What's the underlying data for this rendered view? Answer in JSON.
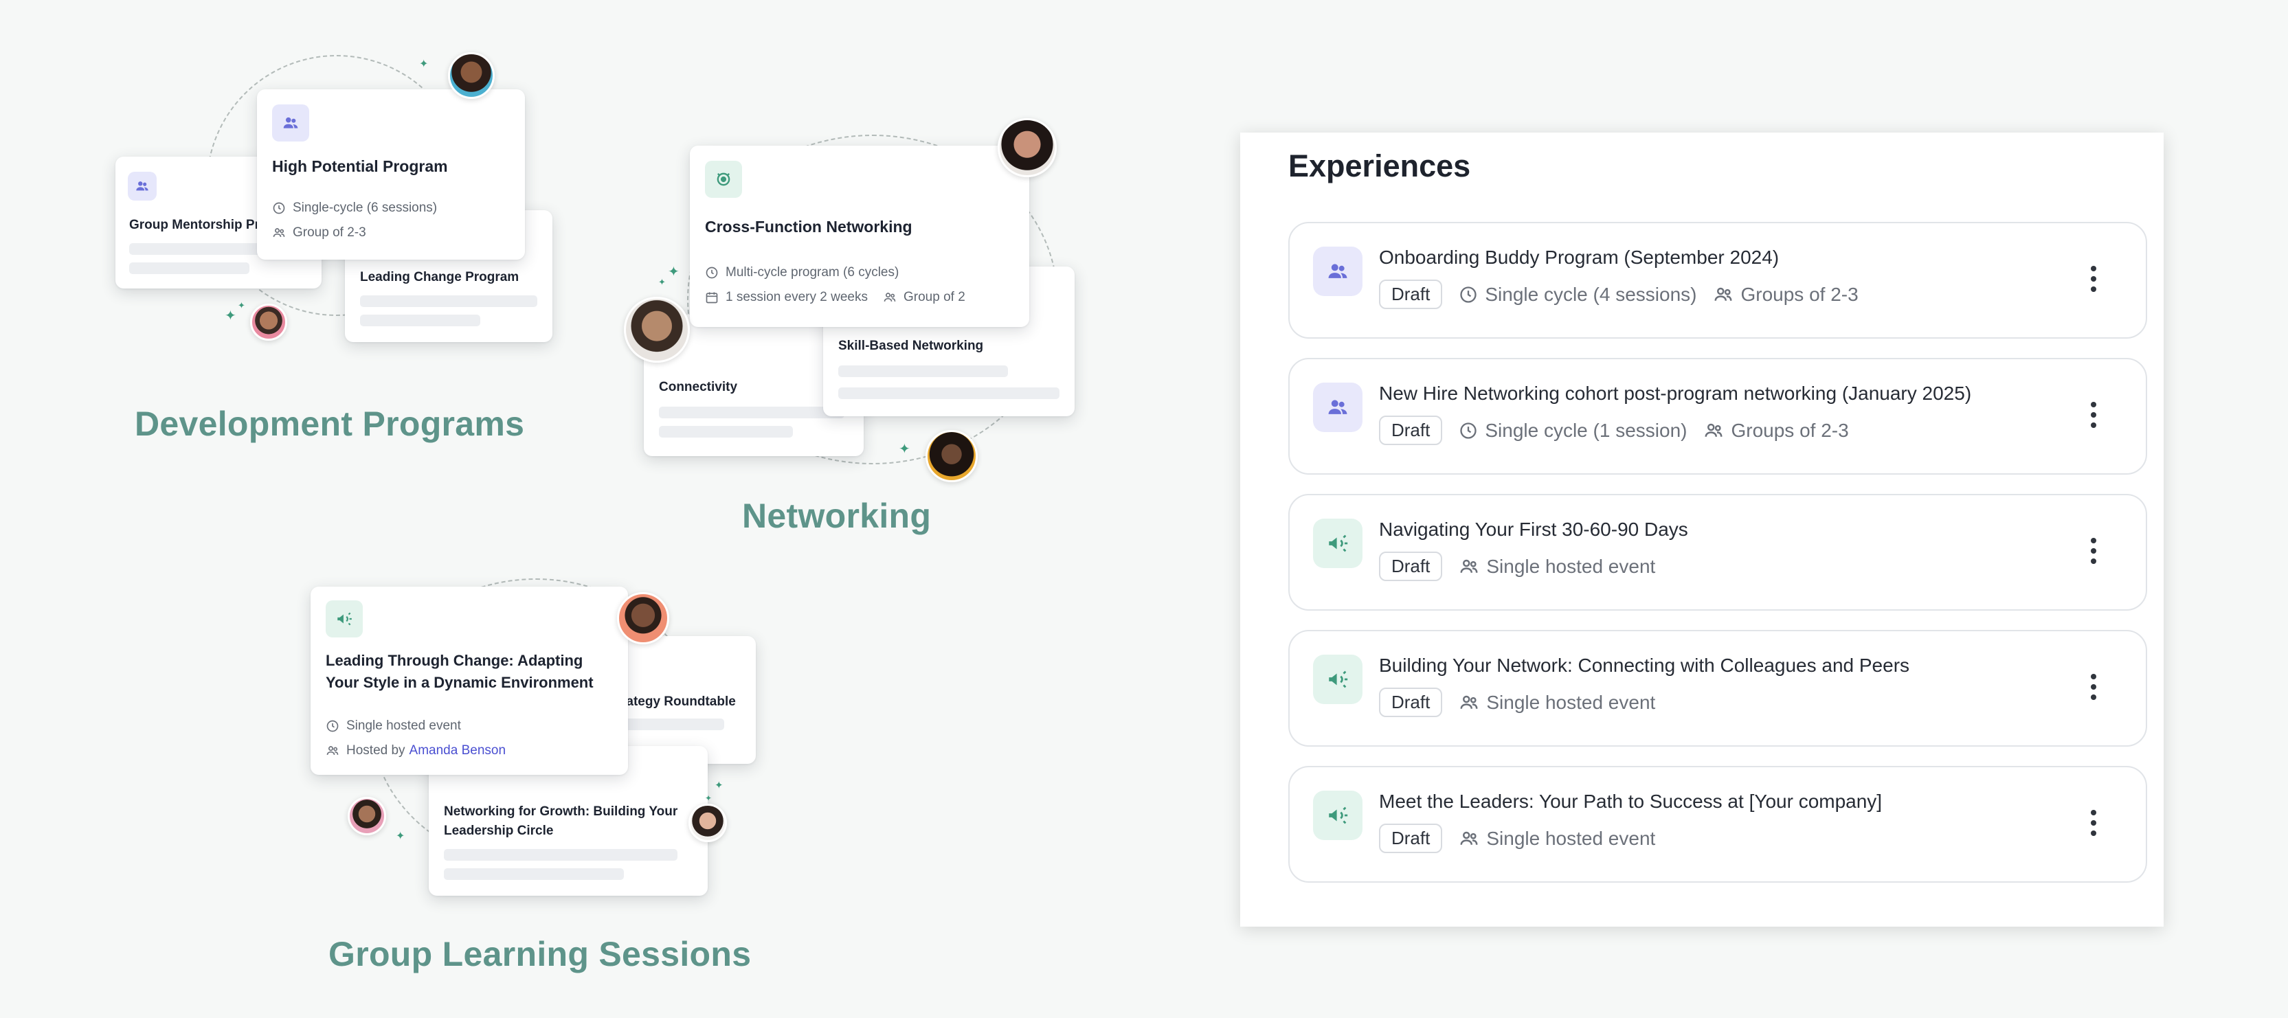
{
  "dev_programs": {
    "label": "Development Programs",
    "cards": {
      "group_mentorship": "Group Mentorship Pr",
      "high_potential": {
        "title": "High Potential Program",
        "cycle": "Single-cycle (6 sessions)",
        "group": "Group of 2-3"
      },
      "leading_change": "Leading Change Program"
    }
  },
  "networking": {
    "label": "Networking",
    "cards": {
      "cross_function": {
        "title": "Cross-Function Networking",
        "cycle": "Multi-cycle program (6 cycles)",
        "frequency": "1 session every 2 weeks",
        "group": "Group of 2"
      },
      "skill_based": "Skill-Based Networking",
      "connectivity": "Connectivity"
    }
  },
  "group_learning": {
    "label": "Group Learning Sessions",
    "cards": {
      "leading_through_change": {
        "title": "Leading Through Change: Adapting Your Style in a Dynamic Environment",
        "event": "Single hosted event",
        "hosted_by": "Hosted by",
        "host_name": "Amanda Benson"
      },
      "strategy": "rategy Roundtable",
      "networking_growth": "Networking for Growth: Building Your Leadership Circle"
    }
  },
  "experiences": {
    "title": "Experiences",
    "rows": [
      {
        "icon": "people-icon",
        "accent": "#6a6fd8",
        "bg": "#e8e8fb",
        "title": "Onboarding Buddy Program (September 2024)",
        "badge": "Draft",
        "cycle": "Single cycle (4 sessions)",
        "group": "Groups of 2-3"
      },
      {
        "icon": "people-icon",
        "accent": "#6a6fd8",
        "bg": "#e8e8fb",
        "title": "New Hire Networking cohort post-program networking (January 2025)",
        "badge": "Draft",
        "cycle": "Single cycle (1 session)",
        "group": "Groups of 2-3"
      },
      {
        "icon": "megaphone-icon",
        "accent": "#3e9a7c",
        "bg": "#e3f4ed",
        "title": "Navigating Your First 30-60-90 Days",
        "badge": "Draft",
        "event": "Single hosted event"
      },
      {
        "icon": "megaphone-icon",
        "accent": "#3e9a7c",
        "bg": "#e3f4ed",
        "title": "Building Your Network: Connecting with Colleagues and Peers",
        "badge": "Draft",
        "event": "Single hosted event"
      },
      {
        "icon": "megaphone-icon",
        "accent": "#3e9a7c",
        "bg": "#e3f4ed",
        "title": "Meet the Leaders: Your Path to Success at [Your company]",
        "badge": "Draft",
        "event": "Single hosted event"
      }
    ]
  }
}
